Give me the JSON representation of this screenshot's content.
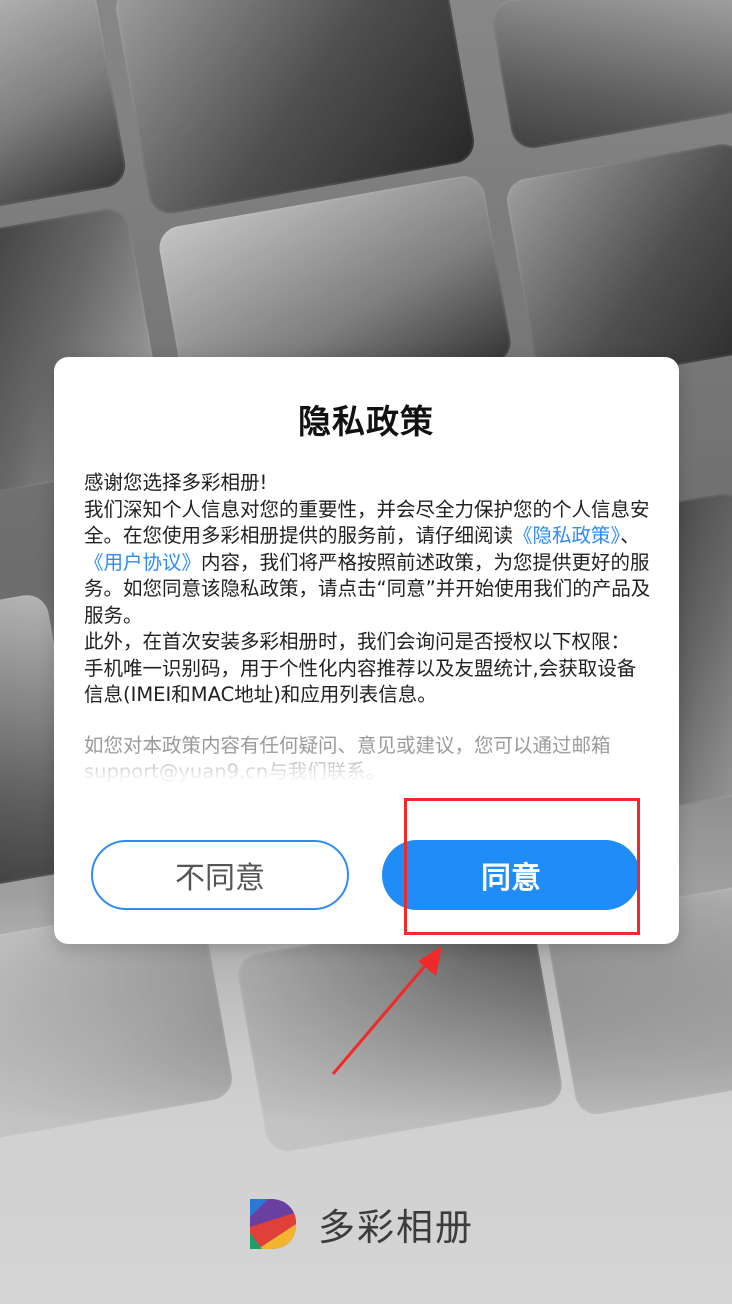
{
  "dialog": {
    "title": "隐私政策",
    "greeting": "感谢您选择多彩相册!",
    "para1_a": "我们深知个人信息对您的重要性，并会尽全力保护您的个人信息安全。在您使用多彩相册提供的服务前，请仔细阅读",
    "privacy_link": "《隐私政策》",
    "sep": "、",
    "agreement_link": "《用户协议》",
    "para1_b": "内容，我们将严格按照前述政策，为您提供更好的服务。如您同意该隐私政策，请点击“同意”并开始使用我们的产品及服务。",
    "para2": "此外，在首次安装多彩相册时，我们会询问是否授权以下权限：",
    "para3": "手机唯一识别码，用于个性化内容推荐以及友盟统计,会获取设备信息(IMEI和MAC地址)和应用列表信息。",
    "contact": "如您对本政策内容有任何疑问、意见或建议，您可以通过邮箱support@yuan9.cn与我们联系。",
    "disagree_label": "不同意",
    "agree_label": "同意"
  },
  "brand": {
    "name": "多彩相册"
  },
  "colors": {
    "accent": "#1f8cf7",
    "link": "#2f8cf5",
    "annotation": "#f0292a"
  }
}
